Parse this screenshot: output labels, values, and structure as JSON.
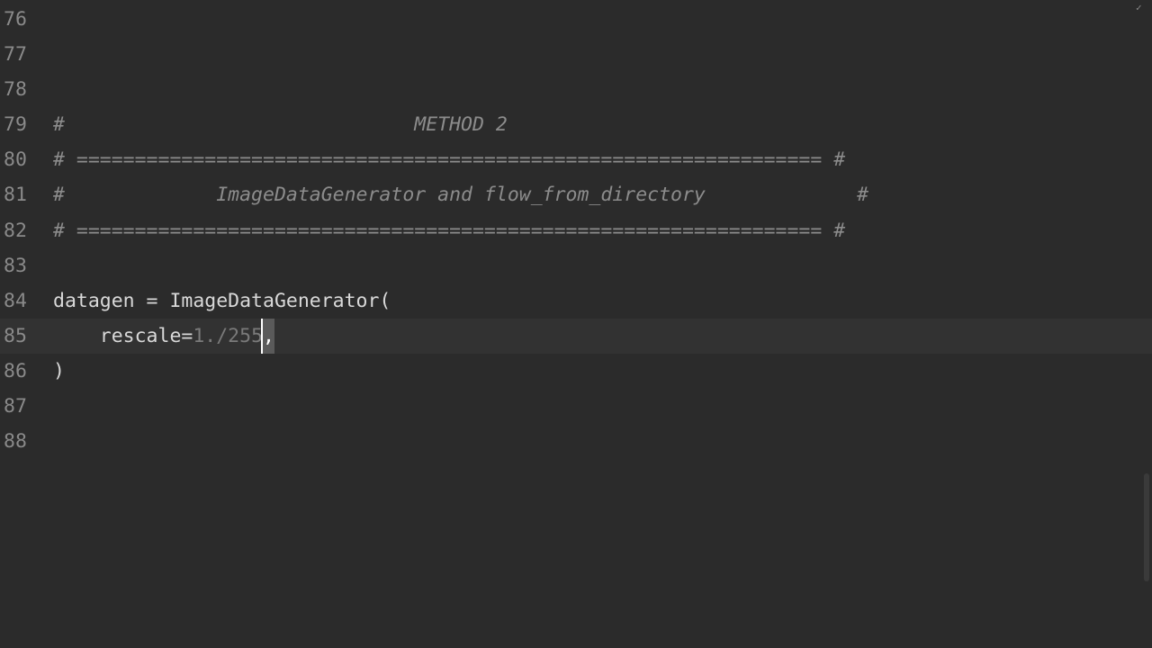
{
  "editor": {
    "status_icon": "check-icon",
    "lines": [
      {
        "number": "76",
        "segments": []
      },
      {
        "number": "77",
        "segments": []
      },
      {
        "number": "78",
        "segments": []
      },
      {
        "number": "79",
        "segments": [
          {
            "type": "comment",
            "text": "#                              METHOD 2"
          }
        ]
      },
      {
        "number": "80",
        "segments": [
          {
            "type": "comment",
            "text": "# ================================================================ #"
          }
        ]
      },
      {
        "number": "81",
        "segments": [
          {
            "type": "comment",
            "text": "#             ImageDataGenerator and flow_from_directory             #"
          }
        ]
      },
      {
        "number": "82",
        "segments": [
          {
            "type": "comment",
            "text": "# ================================================================ #"
          }
        ]
      },
      {
        "number": "83",
        "segments": []
      },
      {
        "number": "84",
        "segments": [
          {
            "type": "ident",
            "text": "datagen = ImageDataGenerator("
          }
        ]
      },
      {
        "number": "85",
        "current": true,
        "segments": [
          {
            "type": "ident",
            "text": "    rescale="
          },
          {
            "type": "num",
            "text": "1./255"
          },
          {
            "type": "caret",
            "text": ","
          }
        ]
      },
      {
        "number": "86",
        "segments": [
          {
            "type": "ident",
            "text": ")"
          }
        ]
      },
      {
        "number": "87",
        "segments": []
      },
      {
        "number": "88",
        "segments": []
      }
    ]
  }
}
